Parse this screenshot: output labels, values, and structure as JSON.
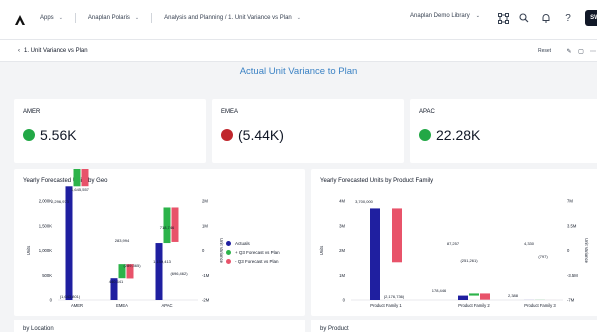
{
  "nav": {
    "apps": "Apps",
    "polaris": "Anaplan Polaris",
    "breadcrumb": "Analysis and Planning / 1. Unit Variance vs Plan",
    "workspace": "Anaplan Demo Library",
    "avatar": "SW"
  },
  "page": {
    "back_label": "1. Unit Variance vs Plan",
    "reset_label": "Reset",
    "title": "Actual Unit Variance to Plan"
  },
  "kpis": [
    {
      "label": "AMER",
      "value": "5.56K",
      "status_color": "#22a846"
    },
    {
      "label": "EMEA",
      "value": "(5.44K)",
      "status_color": "#c0272d"
    },
    {
      "label": "APAC",
      "value": "22.28K",
      "status_color": "#22a846"
    }
  ],
  "colors": {
    "actuals": "#1f1fa0",
    "pos": "#2cb34a",
    "neg": "#e8536a"
  },
  "chart_geo": {
    "title": "Yearly Forecasted Units by Geo",
    "ylabel": "Units",
    "y2label": "Unit Variance",
    "yticks": [
      "0",
      "500K",
      "1,000K",
      "1,500K",
      "2,000K"
    ],
    "y2ticks": [
      "2M",
      "1M",
      "0",
      "-1M",
      "-2M"
    ],
    "legend": [
      "Actuals",
      "+ Q3 Forecast vs Plan",
      "- Q3 Forecast vs Plan"
    ],
    "labels": [
      "2,296,973",
      "1,645,557",
      "(1,643,801)",
      "283,994",
      "440,441",
      "(289,365)",
      "718,746",
      "1,150,413",
      "(696,462)"
    ]
  },
  "chart_data": [
    {
      "type": "bar",
      "title": "Yearly Forecasted Units by Geo",
      "categories": [
        "AMER",
        "EMEA",
        "APAC"
      ],
      "ylabel": "Units",
      "y2label": "Unit Variance",
      "ylim": [
        0,
        2000000
      ],
      "y2lim": [
        -2000000,
        2000000
      ],
      "series": [
        {
          "name": "Actuals",
          "values": [
            2296973,
            440441,
            1150413
          ]
        },
        {
          "name": "+ Q3 Forecast vs Plan",
          "values": [
            1645557,
            283994,
            718746
          ]
        },
        {
          "name": "- Q3 Forecast vs Plan",
          "values": [
            -1643801,
            -289365,
            -696462
          ]
        }
      ],
      "legend": "right"
    },
    {
      "type": "bar",
      "title": "Yearly Forecasted Units by Product Family",
      "categories": [
        "Product Family 1",
        "Product Family 2",
        "Product Family 3"
      ],
      "ylabel": "Units",
      "y2label": "Unit Variance",
      "ylim": [
        0,
        4000000
      ],
      "y2lim": [
        -7000000,
        7000000
      ],
      "series": [
        {
          "name": "Actuals",
          "values": [
            3700000,
            178446,
            2388
          ]
        },
        {
          "name": "+ Q3 Forecast vs Plan",
          "values": [
            null,
            87257,
            4330
          ]
        },
        {
          "name": "- Q3 Forecast vs Plan",
          "values": [
            -2176736,
            -251261,
            -797
          ]
        }
      ]
    }
  ],
  "chart_pf": {
    "title": "Yearly Forecasted Units by Product Family",
    "ylabel": "Units",
    "y2label": "Unit Variance",
    "yticks": [
      "0",
      "1M",
      "2M",
      "3M",
      "4M"
    ],
    "y2ticks": [
      "7M",
      "3.5M",
      "0",
      "-3.5M",
      "-7M"
    ],
    "labels": [
      "3,700,000",
      "(2,176,736)",
      "87,257",
      "178,446",
      "(251,261)",
      "4,330",
      "2,388",
      "(797)"
    ]
  },
  "bottom": {
    "left_title": "by Location",
    "right_title": "by Product"
  }
}
